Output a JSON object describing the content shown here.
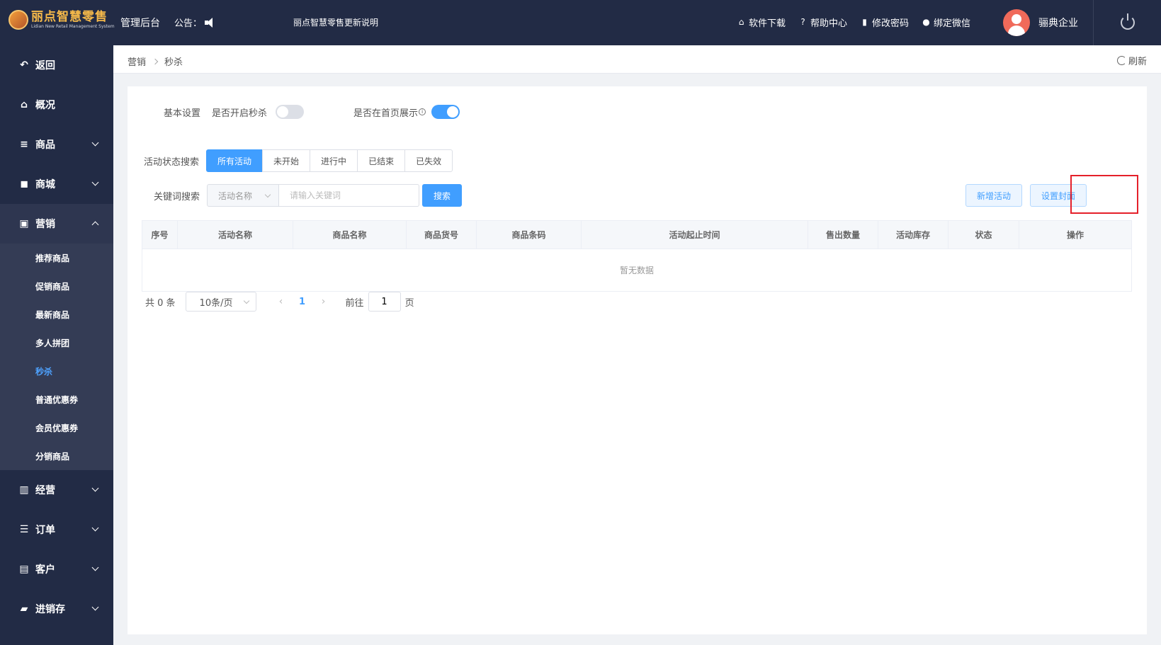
{
  "header": {
    "logo_title": "丽点智慧零售",
    "logo_subtitle": "Lidian New Retail Management System",
    "admin_label": "管理后台",
    "notice_label": "公告：",
    "news": "丽点智慧零售更新说明",
    "links": [
      {
        "label": "软件下载",
        "icon": "store-icon"
      },
      {
        "label": "帮助中心",
        "icon": "help-icon"
      },
      {
        "label": "修改密码",
        "icon": "thermometer-icon"
      },
      {
        "label": "绑定微信",
        "icon": "wechat-icon"
      }
    ],
    "company": "骊典企业"
  },
  "sidebar": {
    "back": "返回",
    "overview": "概况",
    "goods": "商品",
    "mall": "商城",
    "marketing": "营销",
    "marketing_sub": [
      "推荐商品",
      "促销商品",
      "最新商品",
      "多人拼团",
      "秒杀",
      "普通优惠券",
      "会员优惠券",
      "分销商品"
    ],
    "active_sub": "秒杀",
    "operation": "经营",
    "orders": "订单",
    "customers": "客户",
    "inventory": "进销存"
  },
  "breadcrumb": {
    "items": [
      "营销",
      "秒杀"
    ],
    "refresh": "刷新"
  },
  "basic": {
    "label": "基本设置",
    "enable_label": "是否开启秒杀",
    "enable_on": false,
    "home_label": "是否在首页展示",
    "home_on": true
  },
  "status_filter": {
    "label": "活动状态搜索",
    "options": [
      "所有活动",
      "未开始",
      "进行中",
      "已结束",
      "已失效"
    ],
    "selected": "所有活动"
  },
  "keyword_search": {
    "label": "关键词搜索",
    "field": "活动名称",
    "placeholder": "请输入关键词",
    "value": "",
    "search_button": "搜索"
  },
  "actions": {
    "add": "新增活动",
    "cover": "设置封面"
  },
  "table": {
    "columns": [
      "序号",
      "活动名称",
      "商品名称",
      "商品货号",
      "商品条码",
      "活动起止时间",
      "售出数量",
      "活动库存",
      "状态",
      "操作"
    ],
    "empty_text": "暂无数据"
  },
  "pagination": {
    "total": "共 0 条",
    "page_size": "10条/页",
    "current_page": "1",
    "goto_label": "前往",
    "goto_value": "1",
    "page_suffix": "页"
  }
}
